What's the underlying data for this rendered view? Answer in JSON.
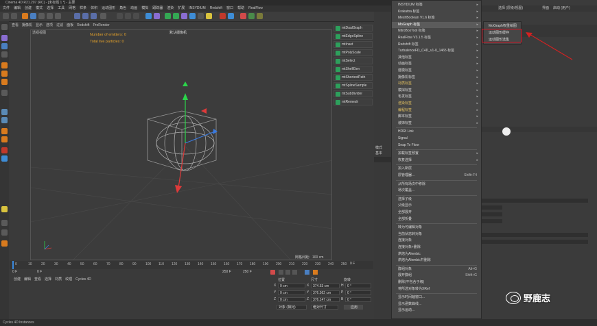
{
  "window": {
    "title": "Cinema 4D R21.207 (RC) - [未标题 1 *] - 主要"
  },
  "menubar": [
    "文件",
    "编辑",
    "创建",
    "模式",
    "选择",
    "工具",
    "网格",
    "样条",
    "体积",
    "运动图形",
    "角色",
    "动画",
    "模拟",
    "跟踪器",
    "渲染",
    "扩展",
    "INSYDIUM",
    "Redshift",
    "窗口",
    "帮助",
    "RealFlow"
  ],
  "viewport": {
    "tabs": [
      "查看",
      "摄像机",
      "显示",
      "选项",
      "过滤",
      "面板",
      "Redshift",
      "ProRender"
    ],
    "label": "透视视图",
    "mode": "默认摄像机",
    "stats": [
      "Number of emitters: 0",
      "Total live particles: 0"
    ],
    "grid_status": "网格间距：100 cm"
  },
  "mograph_objects": [
    "mtDualGraph",
    "mtEdgeSpline",
    "mtInset",
    "mtPolyScale",
    "mtSelect",
    "mtShellGen",
    "mtShortestPath",
    "mtSplineSample",
    "mtSubDivider",
    "mtRemesh"
  ],
  "timeline": {
    "ticks": [
      "0",
      "10",
      "20",
      "30",
      "40",
      "50",
      "60",
      "70",
      "80",
      "90",
      "100",
      "110",
      "120",
      "130",
      "140",
      "150",
      "160",
      "170",
      "180",
      "190",
      "200",
      "210",
      "220",
      "230",
      "240",
      "250"
    ],
    "current": "0 F",
    "start": "0 F",
    "end": "250 F",
    "end2": "250 F",
    "frame_field": "0 F"
  },
  "lower_menu": [
    "创建",
    "编辑",
    "查看",
    "选择",
    "材质",
    "纹理",
    "Cycles 4D"
  ],
  "coords": {
    "headers": [
      "位置",
      "尺寸",
      "旋转"
    ],
    "rows": [
      {
        "axis": "X",
        "pos": "0 cm",
        "size": "374.53 cm",
        "rot_label": "H",
        "rot": "0 °"
      },
      {
        "axis": "Y",
        "pos": "0 cm",
        "size": "376.562 cm",
        "rot_label": "P",
        "rot": "0 °"
      },
      {
        "axis": "Z",
        "pos": "0 cm",
        "size": "376.147 cm",
        "rot_label": "B",
        "rot": "0 °"
      }
    ],
    "mode_select": "对象 (相对)",
    "size_select": "绝对尺寸",
    "apply": "应用"
  },
  "context_menu": {
    "items": [
      {
        "label": "INSYDIUM 标签",
        "arrow": true
      },
      {
        "label": "Krakatoa 标签",
        "arrow": true
      },
      {
        "label": "MeshBoolean V1.6 标签",
        "arrow": true
      },
      {
        "label": "MoGraph 标签",
        "arrow": true,
        "selected": true
      },
      {
        "label": "NitroBoxTool 标签",
        "arrow": true
      },
      {
        "label": "RealFlow V3.1.5 标签",
        "arrow": true
      },
      {
        "label": "Redshift 标签",
        "arrow": true
      },
      {
        "label": "TurbulenceFD_C4D_v1-0_1465 标签",
        "arrow": true
      },
      {
        "label": "其他标签",
        "arrow": true
      },
      {
        "label": "动画标签",
        "arrow": true
      },
      {
        "label": "建模标签",
        "arrow": true
      },
      {
        "label": "摄像机标签",
        "arrow": true
      },
      {
        "label": "材质标签",
        "arrow": true,
        "gold": true
      },
      {
        "label": "模拟标签",
        "arrow": true
      },
      {
        "label": "毛发标签",
        "arrow": true
      },
      {
        "label": "渲染标签",
        "arrow": true,
        "gold": true
      },
      {
        "label": "编程标签",
        "arrow": true,
        "gold": true
      },
      {
        "label": "脚本标签",
        "arrow": true
      },
      {
        "label": "装饰标签",
        "arrow": true
      }
    ],
    "items2": [
      {
        "label": "HDRI Link"
      },
      {
        "label": "Signal"
      },
      {
        "label": "Snap To Floor"
      }
    ],
    "items3": [
      {
        "label": "加载标签预置",
        "arrow": true
      },
      {
        "label": "恢复选择",
        "arrow": true
      },
      {
        "label": "加入新层"
      },
      {
        "label": "层管理器...",
        "shortcut": "Shift+F4"
      },
      {
        "label": "从所有场次中移除"
      },
      {
        "label": "场次覆盖..."
      },
      {
        "label": "选择子级"
      },
      {
        "label": "父级显示"
      },
      {
        "label": "全部展开"
      },
      {
        "label": "全部折叠"
      },
      {
        "label": "转为可编辑对象"
      },
      {
        "label": "当前状态转对象"
      },
      {
        "label": "连接对象"
      },
      {
        "label": "连接对象+删除"
      },
      {
        "label": "烘焙为Alembic"
      },
      {
        "label": "烘焙为Alembic并删除"
      },
      {
        "label": "群组对象",
        "shortcut": "Alt+G"
      },
      {
        "label": "展开群组",
        "shortcut": "Shift+G"
      },
      {
        "label": "删除(不包含子级)"
      },
      {
        "label": "将所选对象转为XRef"
      },
      {
        "label": "显示时间轴窗口..."
      },
      {
        "label": "显示函数曲线..."
      },
      {
        "label": "显示运动..."
      }
    ]
  },
  "submenu": {
    "items": [
      "MoGraph权重绘图",
      "运动图形缓存",
      "运动图形选集"
    ]
  },
  "right_panel": {
    "tabs": [
      "选择 (层级/视图)",
      "界面",
      "启动 (用户)"
    ]
  },
  "statusbar": {
    "text": "Cycles 4D Instances"
  },
  "watermark": {
    "text": "野鹿志"
  },
  "colors": {
    "accent_orange": "#e6a32a",
    "highlight_red": "#d12222",
    "mograph_green": "#2da05c"
  }
}
